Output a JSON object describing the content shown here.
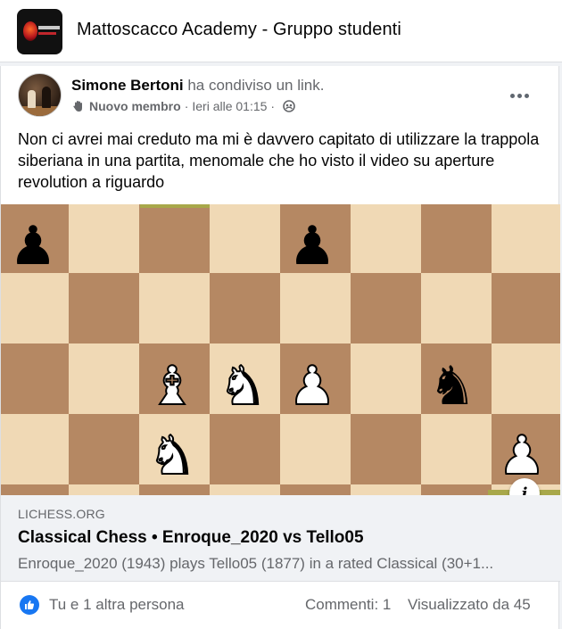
{
  "group": {
    "title": "Mattoscacco Academy - Gruppo studenti"
  },
  "post": {
    "author": "Simone Bertoni",
    "action": " ha condiviso un link.",
    "badge": "Nuovo membro",
    "separator": "·",
    "time": "Ieri alle 01:15",
    "separator2": "·",
    "text": "Non ci avrei mai creduto ma mi è davvero capitato di utilizzare la trappola siberiana in una partita, menomale che ho visto il video su aperture revolution a riguardo"
  },
  "board": {
    "pieces": [
      {
        "glyph": "♟",
        "color": "black",
        "name": "black-pawn-a"
      },
      {
        "glyph": "♟",
        "color": "black",
        "name": "black-pawn-e"
      },
      {
        "glyph": "♗",
        "color": "white",
        "name": "white-bishop-c4"
      },
      {
        "glyph": "♘",
        "color": "white",
        "name": "white-knight-d4"
      },
      {
        "glyph": "♙",
        "color": "white",
        "name": "white-pawn-e4"
      },
      {
        "glyph": "♞",
        "color": "black",
        "name": "black-knight-g4"
      },
      {
        "glyph": "♘",
        "color": "white",
        "name": "white-knight-c3"
      },
      {
        "glyph": "♙",
        "color": "white",
        "name": "white-pawn-h3"
      }
    ],
    "info_label": "i"
  },
  "link": {
    "domain": "LICHESS.ORG",
    "title": "Classical Chess • Enroque_2020 vs Tello05",
    "description": "Enroque_2020 (1943) plays Tello05 (1877) in a rated Classical (30+1..."
  },
  "footer": {
    "likes": "Tu e 1 altra persona",
    "comments": "Commenti: 1",
    "views": "Visualizzato da 45"
  },
  "colors": {
    "accent": "#1877f2",
    "board_light": "#f0d9b5",
    "board_dark": "#b58863",
    "highlight": "#a8a84a"
  }
}
